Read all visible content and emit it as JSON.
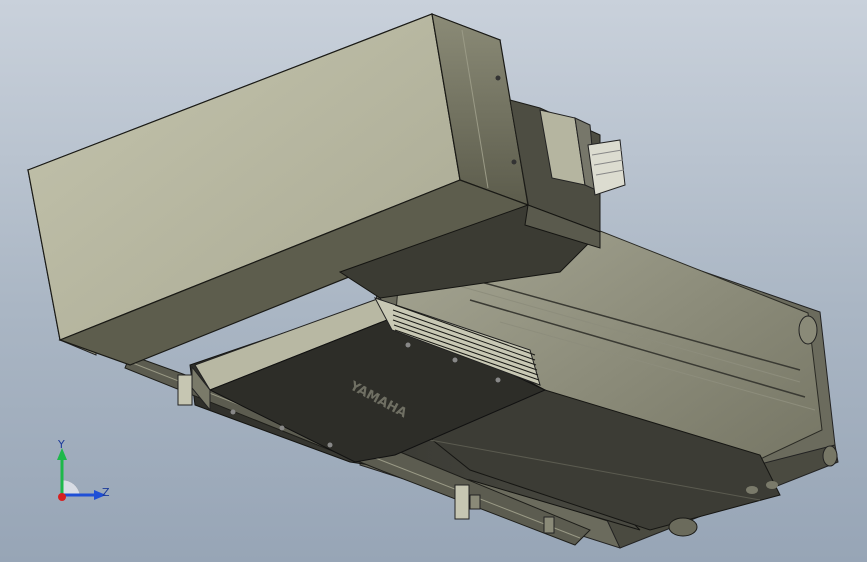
{
  "viewport": {
    "background_top": "#c9d1db",
    "background_bottom": "#97a5b6"
  },
  "model": {
    "housing_color": "#b3b39d",
    "housing_shadow": "#6f6f5c",
    "base_color": "#3a3a34",
    "rail_color": "#5a5a50",
    "logo_text": "YAMAHA"
  },
  "triad": {
    "y_label": "Y",
    "z_label": "Z",
    "y_color": "#1db84a",
    "z_color": "#1f4fd6",
    "x_color": "#d62020"
  }
}
